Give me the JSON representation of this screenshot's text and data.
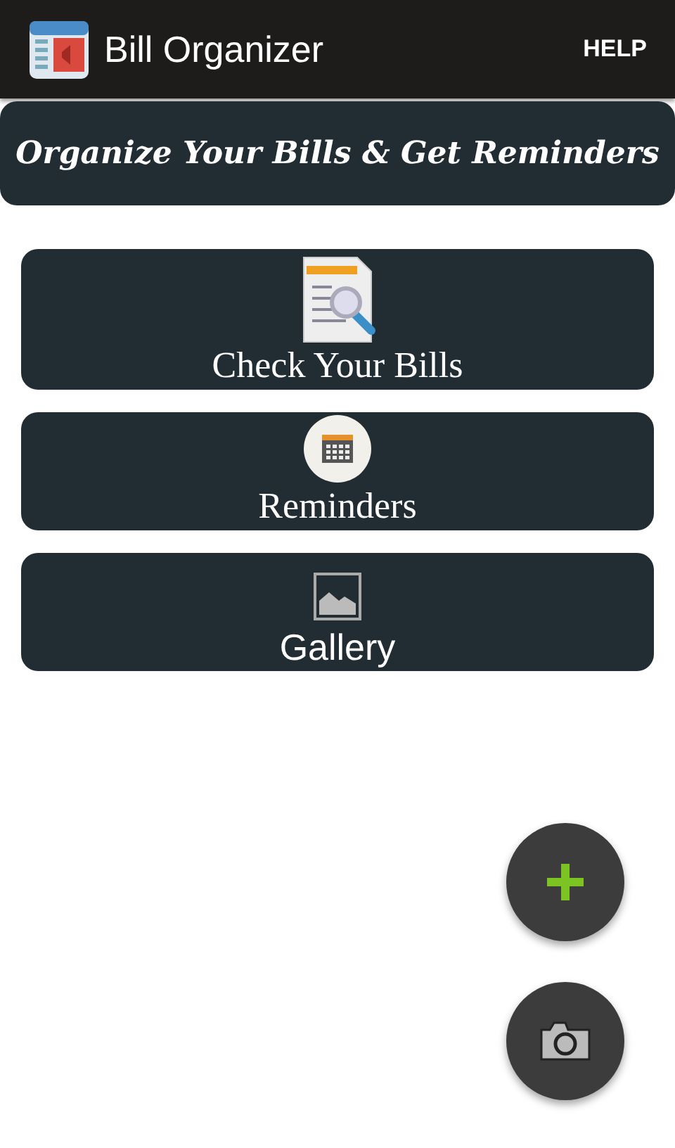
{
  "app_bar": {
    "title": "Bill Organizer",
    "action": "HELP"
  },
  "banner": {
    "text": "Organize Your Bills & Get Reminders"
  },
  "menu": [
    {
      "label": "Check Your Bills",
      "kind": "document"
    },
    {
      "label": "Reminders",
      "kind": "calendar"
    },
    {
      "label": "Gallery",
      "kind": "image"
    }
  ],
  "fabs": [
    {
      "kind": "add"
    },
    {
      "kind": "camera"
    }
  ]
}
